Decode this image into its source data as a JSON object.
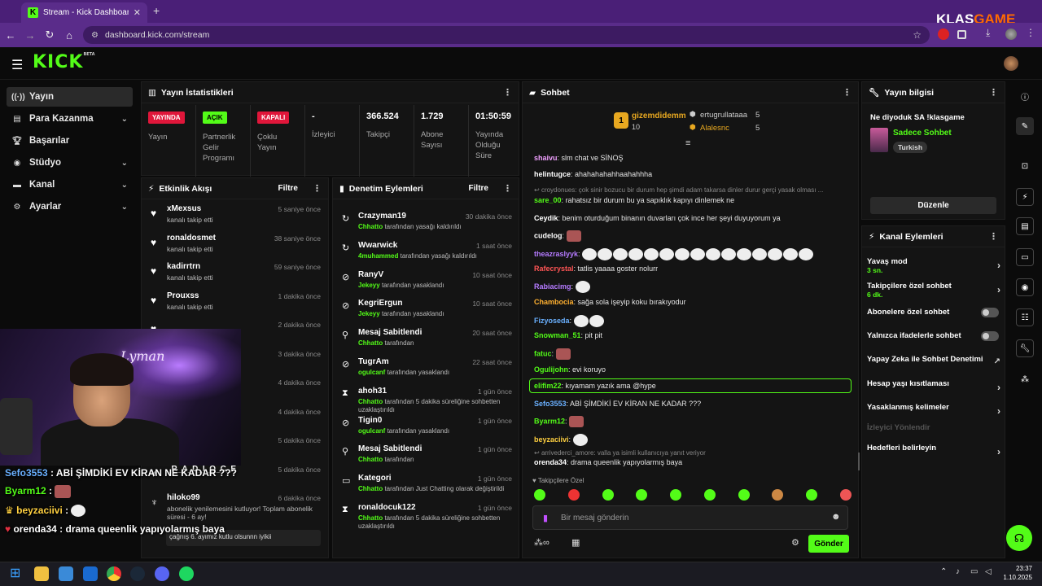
{
  "browser": {
    "tab_title": "Stream - Kick Dashboard",
    "url": "dashboard.kick.com/stream",
    "watermark_a": "KLAS",
    "watermark_b": "GAME"
  },
  "brand": {
    "logo": "KICK",
    "beta": "BETA",
    "accent": "#53fc18"
  },
  "sidebar": {
    "items": [
      {
        "label": "Yayın"
      },
      {
        "label": "Para Kazanma"
      },
      {
        "label": "Başarılar"
      },
      {
        "label": "Stüdyo"
      },
      {
        "label": "Kanal"
      },
      {
        "label": "Ayarlar"
      }
    ]
  },
  "stats": {
    "title": "Yayın İstatistikleri",
    "items": [
      {
        "badge": "YAYINDA",
        "label": "Yayın"
      },
      {
        "badge": "AÇIK",
        "label": "Partnerlik Gelir Programı"
      },
      {
        "badge": "KAPALI",
        "label": "Çoklu Yayın"
      },
      {
        "value": "-",
        "label": "İzleyici"
      },
      {
        "value": "366.524",
        "label": "Takipçi"
      },
      {
        "value": "1.729",
        "label": "Abone Sayısı"
      },
      {
        "value": "01:50:59",
        "label": "Yayında Olduğu Süre"
      }
    ]
  },
  "activity": {
    "title": "Etkinlik Akışı",
    "filter": "Filtre",
    "items": [
      {
        "name": "xMexsus",
        "sub": "kanalı takip etti",
        "time": "5 saniye önce"
      },
      {
        "name": "ronaldosmet",
        "sub": "kanalı takip etti",
        "time": "38 saniye önce"
      },
      {
        "name": "kadirrtrn",
        "sub": "kanalı takip etti",
        "time": "59 saniye önce"
      },
      {
        "name": "Prouxss",
        "sub": "kanalı takip etti",
        "time": "1 dakika önce"
      },
      {
        "name": "",
        "sub": "",
        "time": "2 dakika önce"
      },
      {
        "name": "",
        "sub": "",
        "time": "3 dakika önce"
      },
      {
        "name": "",
        "sub": "",
        "time": "4 dakika önce"
      },
      {
        "name": "",
        "sub": "",
        "time": "4 dakika önce"
      },
      {
        "name": "",
        "sub": "",
        "time": "5 dakika önce"
      },
      {
        "name": "_R_A_D_I_O_C_E",
        "sub": "",
        "time": "5 dakika önce"
      },
      {
        "name": "hiloko99",
        "sub": "abonelik yenilemesini kutluyor! Toplam abonelik süresi - 6 ay!",
        "time": "6 dakika önce"
      }
    ],
    "last_message": "çağrıış 6. ayımız kutlu olsunnn iyikii"
  },
  "moderation": {
    "title": "Denetim Eylemleri",
    "filter": "Filtre",
    "items": [
      {
        "name": "Crazyman19",
        "by": "Chhatto",
        "sub": "tarafından yasağı kaldırıldı",
        "time": "30 dakika önce",
        "icon": "↻"
      },
      {
        "name": "Wwarwick",
        "by": "4muhammed",
        "sub": "tarafından yasağı kaldırıldı",
        "time": "1 saat önce",
        "icon": "↻"
      },
      {
        "name": "RanyV",
        "by": "Jekeyy",
        "sub": "tarafından yasaklandı",
        "time": "10 saat önce",
        "icon": "⊘"
      },
      {
        "name": "KegriErgun",
        "by": "Jekeyy",
        "sub": "tarafından yasaklandı",
        "time": "10 saat önce",
        "icon": "⊘"
      },
      {
        "name": "Mesaj Sabitlendi",
        "by": "Chhatto",
        "sub": "tarafından",
        "time": "20 saat önce",
        "icon": "⚲"
      },
      {
        "name": "TugrAm",
        "by": "ogulcanf",
        "sub": "tarafından yasaklandı",
        "time": "22 saat önce",
        "icon": "⊘"
      },
      {
        "name": "ahoh31",
        "by": "Chhatto",
        "sub": "tarafından 5 dakika süreliğine sohbetten uzaklaştırıldı",
        "time": "1 gün önce",
        "icon": "⧗"
      },
      {
        "name": "Tigin0",
        "by": "ogulcanf",
        "sub": "tarafından yasaklandı",
        "time": "1 gün önce",
        "icon": "⊘"
      },
      {
        "name": "Mesaj Sabitlendi",
        "by": "Chhatto",
        "sub": "tarafından",
        "time": "1 gün önce",
        "icon": "⚲"
      },
      {
        "name": "Kategori",
        "by": "Chhatto",
        "sub": "tarafından Just Chatting olarak değiştirildi",
        "time": "1 gün önce",
        "icon": "▭"
      },
      {
        "name": "ronaldocuk122",
        "by": "Chhatto",
        "sub": "tarafından 5 dakika süreliğine sohbetten uzaklaştırıldı",
        "time": "1 gün önce",
        "icon": "⧗"
      }
    ]
  },
  "chat": {
    "title": "Sohbet",
    "leaders": [
      {
        "rank": "1",
        "name": "gizemdidemm",
        "count": "10"
      },
      {
        "name": "ertugrullataaa",
        "count": "5"
      },
      {
        "name": "Alalesnc",
        "count": "5"
      }
    ],
    "messages": [
      {
        "user": "shaivu",
        "color": "#f0a0ff",
        "text": "slm chat ve SİNOŞ"
      },
      {
        "user": "helintugce",
        "color": "#ffffff",
        "text": "ahahahahahhaahahhha"
      },
      {
        "reply": "croydonues: çok sinir bozucu bir durum hep şimdi adam takarsa dinler durur gerçi yasak olması ..."
      },
      {
        "user": "sare_00",
        "color": "#53fc18",
        "text": "rahatsız bir durum bu ya sapıklık kapıyı dinlemek ne"
      },
      {
        "user": "Ceydik",
        "color": "#ffffff",
        "text": "benim oturduğum binanın duvarları çok ince her şeyi duyuyorum ya"
      },
      {
        "user": "cudelog",
        "color": "#ffffff",
        "text": ""
      },
      {
        "user": "theazraslyyk",
        "color": "#b57bff",
        "text": ""
      },
      {
        "user": "Rafecrystal",
        "color": "#ff5555",
        "text": "tatlis yaaaa goster nolurr"
      },
      {
        "user": "Rabiacimg",
        "color": "#b57bff",
        "text": ""
      },
      {
        "user": "Chambocia",
        "color": "#ffb030",
        "text": "sağa sola işeyip koku bırakıyodur"
      },
      {
        "user": "Fizyoseda",
        "color": "#6ab0ff",
        "text": ""
      },
      {
        "user": "Snowman_51",
        "color": "#53fc18",
        "text": "pit pit"
      },
      {
        "user": "fatuc",
        "color": "#53fc18",
        "text": ""
      },
      {
        "user": "Ogulijohn",
        "color": "#53fc18",
        "text": "evi koruyo"
      },
      {
        "user": "elifim22",
        "color": "#53fc18",
        "text": "kıyamam yazık ama @hype"
      },
      {
        "user": "Sefo3553",
        "color": "#6ab0ff",
        "text": "ABİ ŞİMDİKİ EV KİRAN NE KADAR ???"
      },
      {
        "user": "Byarm12",
        "color": "#53fc18",
        "text": ""
      },
      {
        "user": "beyzaciivi",
        "color": "#ffd040",
        "text": ""
      },
      {
        "reply": "arrivederci_amore: valla ya isimli kullanıcıya yanıt veriyor"
      },
      {
        "user": "orenda34",
        "color": "#ffffff",
        "text": "drama queenlik yapıyolarmış baya"
      }
    ],
    "followers_only": "Takipçilere Özel",
    "input_placeholder": "Bir mesaj gönderin",
    "send_label": "Gönder"
  },
  "stream_info": {
    "title": "Yayın bilgisi",
    "stream_title": "Ne diyoduk SA !klasgame",
    "category": "Sadece Sohbet",
    "language": "Turkish",
    "edit_label": "Düzenle"
  },
  "channel_actions": {
    "title": "Kanal Eylemleri",
    "items": [
      {
        "label": "Yavaş mod",
        "sub": "3 sn.",
        "type": "arrow"
      },
      {
        "label": "Takipçilere özel sohbet",
        "sub": "6 dk.",
        "type": "arrow"
      },
      {
        "label": "Abonelere özel sohbet",
        "type": "toggle"
      },
      {
        "label": "Yalnızca ifadelerle sohbet",
        "type": "toggle"
      },
      {
        "label": "Yapay Zeka ile Sohbet Denetimi",
        "type": "external"
      },
      {
        "label": "Hesap yaşı kısıtlaması",
        "type": "arrow"
      },
      {
        "label": "Yasaklanmış kelimeler",
        "type": "arrow"
      },
      {
        "label": "İzleyici Yönlendir",
        "type": "disabled"
      },
      {
        "label": "Hedefleri belirleyin",
        "type": "arrow"
      }
    ]
  },
  "overlay": {
    "lines": [
      {
        "user": "Sefo3553",
        "color": "#6ab0ff",
        "text": "ABİ ŞİMDİKİ EV KİRAN NE KADAR ???"
      },
      {
        "user": "Byarm12",
        "color": "#53fc18",
        "text": ""
      },
      {
        "user": "beyzaciivi",
        "color": "#ffd040",
        "text": ""
      },
      {
        "user": "orenda34",
        "color": "#ffffff",
        "text": "drama queenlik yapıyolarmış baya"
      }
    ],
    "cam_caption": "Lyman"
  },
  "taskbar": {
    "time": "23:37",
    "date": "1.10.2025"
  }
}
